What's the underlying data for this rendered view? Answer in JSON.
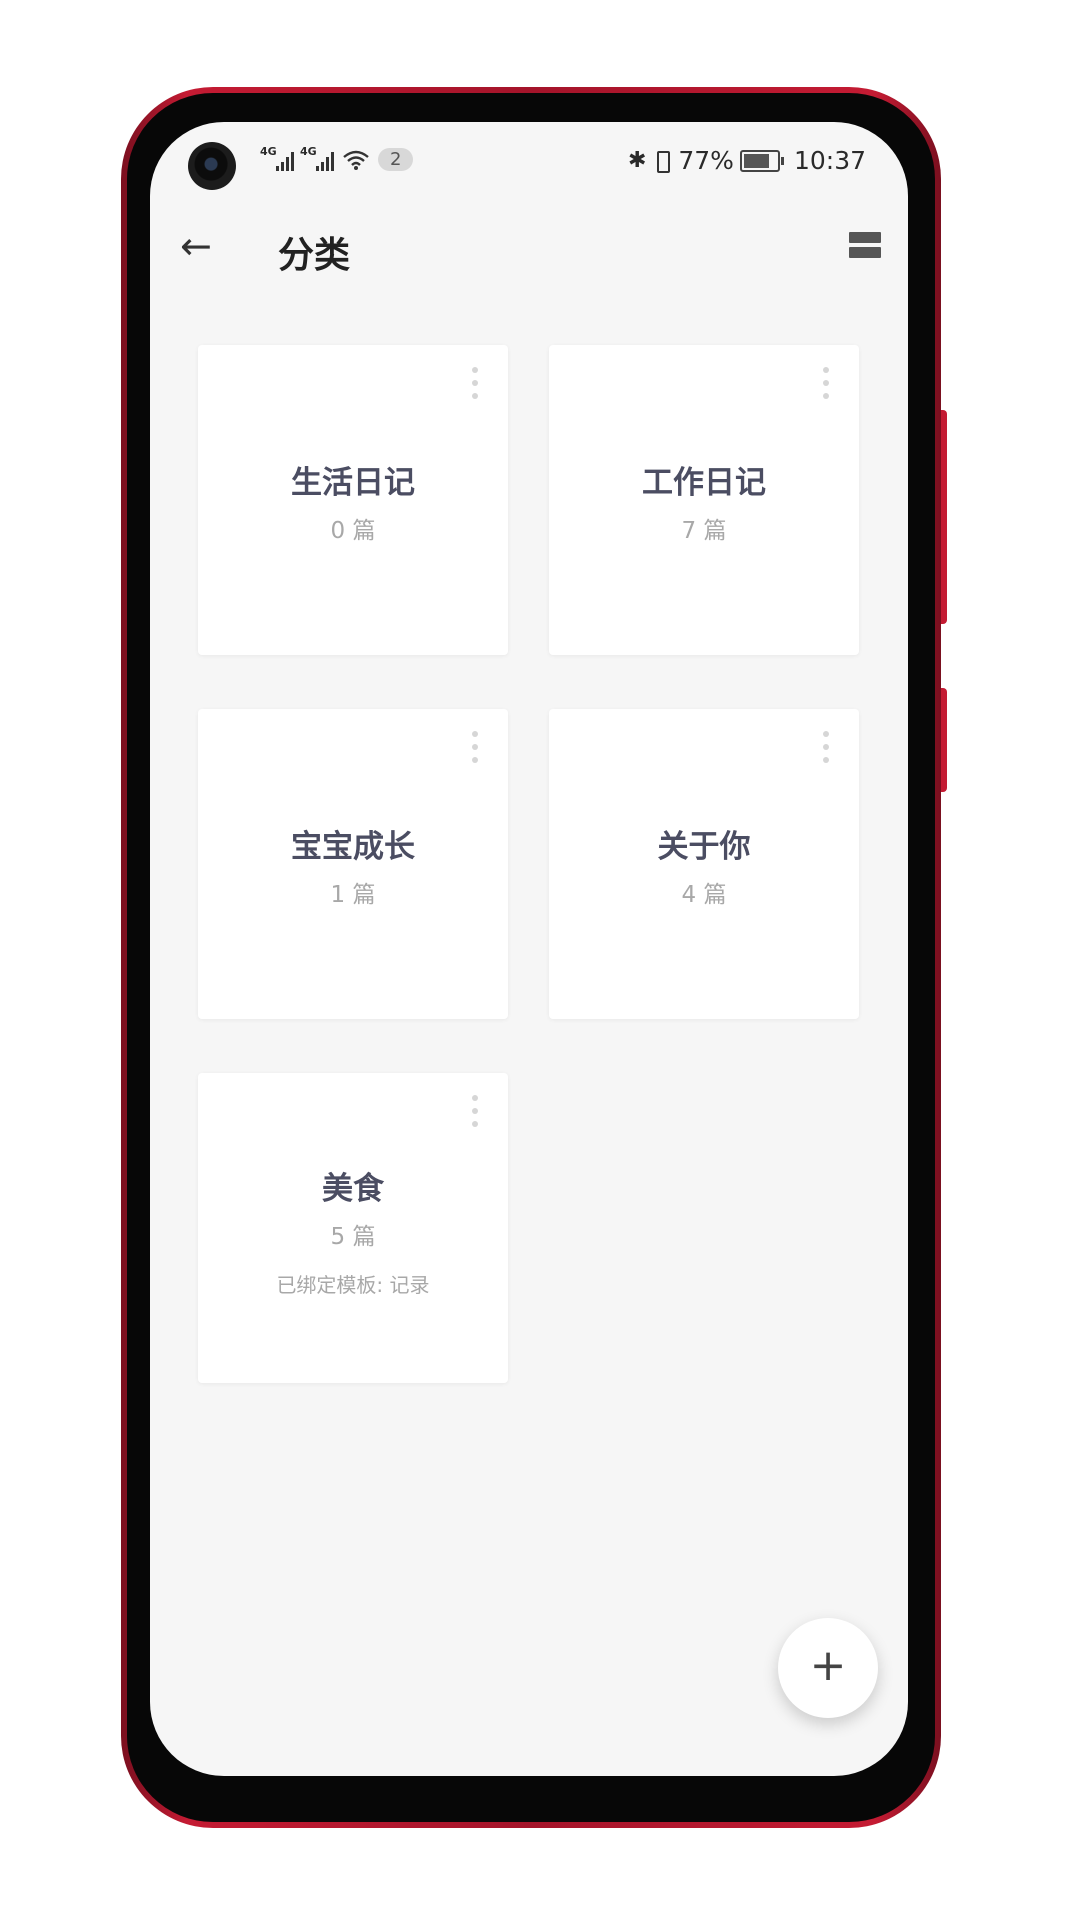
{
  "status_bar": {
    "net1": "4G",
    "net2": "4G",
    "wifi_badge": "2",
    "bluetooth": "✱",
    "battery_pct": "77%",
    "time": "10:37"
  },
  "app_bar": {
    "back": "←",
    "title": "分类"
  },
  "categories": [
    {
      "name": "生活日记",
      "count": "0 篇"
    },
    {
      "name": "工作日记",
      "count": "7 篇"
    },
    {
      "name": "宝宝成长",
      "count": "1 篇"
    },
    {
      "name": "关于你",
      "count": "4 篇"
    },
    {
      "name": "美食",
      "count": "5 篇",
      "template": "已绑定模板: 记录"
    }
  ],
  "fab": {
    "label": "+"
  },
  "battery_level": 0.77
}
